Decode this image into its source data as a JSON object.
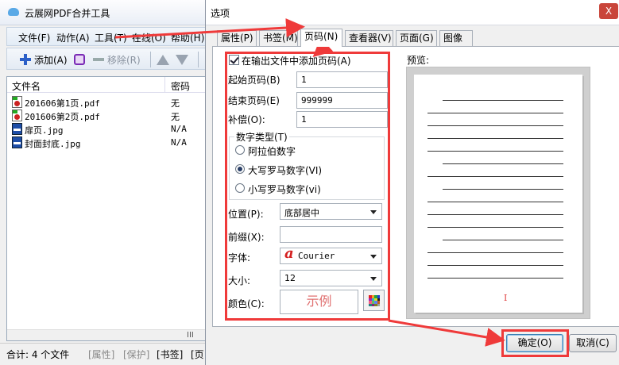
{
  "main_window": {
    "title": "云展网PDF合并工具",
    "menu": [
      "文件(F)",
      "动作(A)",
      "工具(T)",
      "在线(O)",
      "帮助(H)"
    ],
    "toolbar": {
      "add": "添加(A)",
      "remove": "移除(R)"
    },
    "filelist": {
      "col_name": "文件名",
      "col_password": "密码",
      "rows": [
        {
          "name": "201606第1页.pdf",
          "password": "无",
          "icon": "pdf-icon"
        },
        {
          "name": "201606第2页.pdf",
          "password": "无",
          "icon": "pdf-icon"
        },
        {
          "name": "扉页.jpg",
          "password": "N/A",
          "icon": "picture-icon"
        },
        {
          "name": "封面封底.jpg",
          "password": "N/A",
          "icon": "picture-icon"
        }
      ],
      "scroll_mark": "III"
    },
    "status": {
      "total": "合计: 4 个文件",
      "attr": "[属性]",
      "protect": "[保护]",
      "bookmark": "[书签]",
      "page": "[页"
    }
  },
  "dialog": {
    "title": "选项",
    "close": "X",
    "tabs": [
      "属性(P)",
      "书签(M)",
      "页码(N)",
      "查看器(V)",
      "页面(G)",
      "图像"
    ],
    "active_tab": 2,
    "add_page_numbers": "在输出文件中添加页码(A)",
    "start_label": "起始页码(B)",
    "start_value": "1",
    "end_label": "结束页码(E)",
    "end_value": "999999",
    "offset_label": "补偿(O):",
    "offset_value": "1",
    "numtype": {
      "title": "数字类型(T)",
      "options": [
        "阿拉伯数字",
        "大写罗马数字(VI)",
        "小写罗马数字(vi)"
      ],
      "selected": 1
    },
    "position_label": "位置(P):",
    "position_value": "底部居中",
    "prefix_label": "前缀(X):",
    "prefix_value": "",
    "font_label": "字体:",
    "font_value": "Courier",
    "size_label": "大小:",
    "size_value": "12",
    "color_label": "颜色(C):",
    "sample_text": "示例",
    "preview_label": "预览:",
    "preview_pagenum": "I",
    "ok": "确定(O)",
    "cancel": "取消(C)"
  },
  "colors": {
    "annotation_red": "#ef3a3a",
    "sample_text": "#e07070",
    "font_icon": "#d42020"
  }
}
